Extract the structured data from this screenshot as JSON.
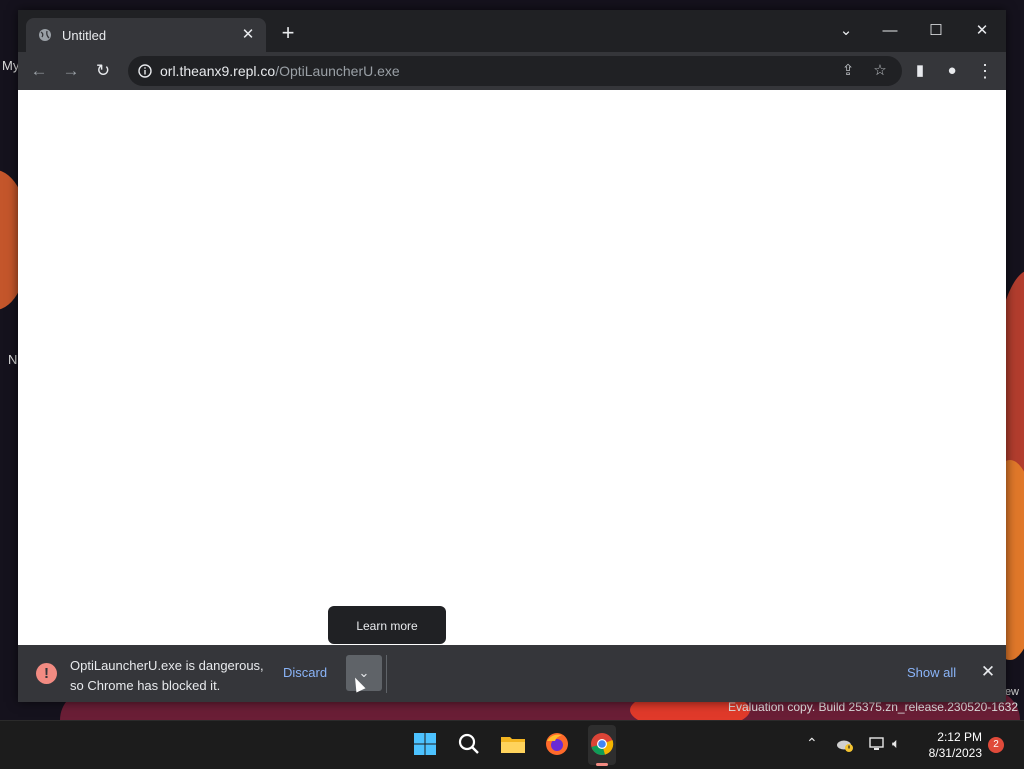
{
  "desktop": {
    "left_labels": [
      "My",
      "N"
    ],
    "watermark_fragment": "ew",
    "evaluation_text": "Evaluation copy. Build 25375.zn_release.230520-1632"
  },
  "browser": {
    "tab": {
      "title": "Untitled",
      "icon": "globe-icon",
      "close_icon": "close-icon"
    },
    "new_tab_icon": "plus-icon",
    "window_controls": [
      "chevron-down-icon",
      "minimize-icon",
      "maximize-icon",
      "close-icon"
    ],
    "address_bar": {
      "domain": "orl.theanx9.repl.co",
      "path": "/OptiLauncherU.exe",
      "icons": [
        "info-icon",
        "share-icon",
        "star-icon"
      ]
    },
    "toolbar_icons": [
      "back-icon",
      "forward-icon",
      "reload-icon",
      "side-panel-icon",
      "profile-icon",
      "menu-icon"
    ]
  },
  "download_bar": {
    "message_line1": "OptiLauncherU.exe is dangerous,",
    "message_line2": "so Chrome has blocked it.",
    "discard_label": "Discard",
    "tooltip_label": "Learn more",
    "show_all_label": "Show all",
    "alert_color": "#f28b82",
    "link_color": "#8ab4f8"
  },
  "taskbar": {
    "apps": [
      "windows-start-icon",
      "search-icon",
      "file-explorer-icon",
      "firefox-icon",
      "chrome-icon"
    ],
    "active_app": "chrome-icon",
    "tray_icons": [
      "chevron-up-icon",
      "onedrive-warning-icon",
      "network-icon",
      "volume-icon"
    ],
    "time": "2:12 PM",
    "date": "8/31/2023",
    "notification_count": "2"
  }
}
